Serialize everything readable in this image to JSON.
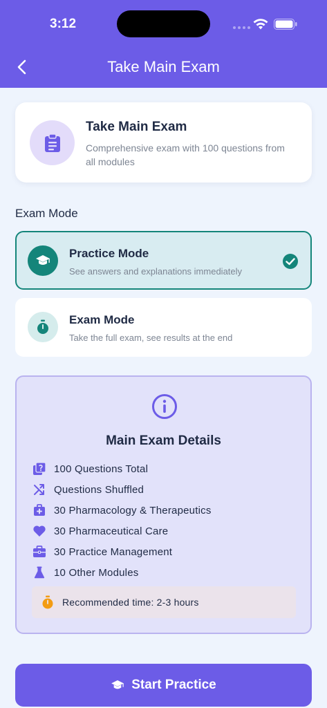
{
  "status_bar": {
    "time": "3:12"
  },
  "header": {
    "title": "Take Main Exam"
  },
  "overview_card": {
    "title": "Take Main Exam",
    "description": "Comprehensive exam with 100 questions from all modules",
    "icon": "clipboard-icon"
  },
  "mode_section": {
    "label": "Exam Mode",
    "modes": [
      {
        "title": "Practice Mode",
        "description": "See answers and explanations immediately",
        "icon": "graduation-cap-icon",
        "selected": true
      },
      {
        "title": "Exam Mode",
        "description": "Take the full exam, see results at the end",
        "icon": "stopwatch-icon",
        "selected": false
      }
    ]
  },
  "details": {
    "title": "Main Exam Details",
    "items": [
      {
        "text": "100 Questions Total",
        "icon": "question-box-icon"
      },
      {
        "text": "Questions Shuffled",
        "icon": "shuffle-icon"
      },
      {
        "text": "30 Pharmacology & Therapeutics",
        "icon": "medkit-icon"
      },
      {
        "text": "30 Pharmaceutical Care",
        "icon": "heart-icon"
      },
      {
        "text": "30 Practice Management",
        "icon": "briefcase-icon"
      },
      {
        "text": "10 Other Modules",
        "icon": "flask-icon"
      }
    ],
    "recommendation": "Recommended time: 2-3 hours"
  },
  "start_button": {
    "label": "Start Practice"
  },
  "colors": {
    "primary": "#6c5ce7",
    "teal": "#14857a",
    "background": "#eef4fd",
    "timer_orange": "#f39c12"
  }
}
